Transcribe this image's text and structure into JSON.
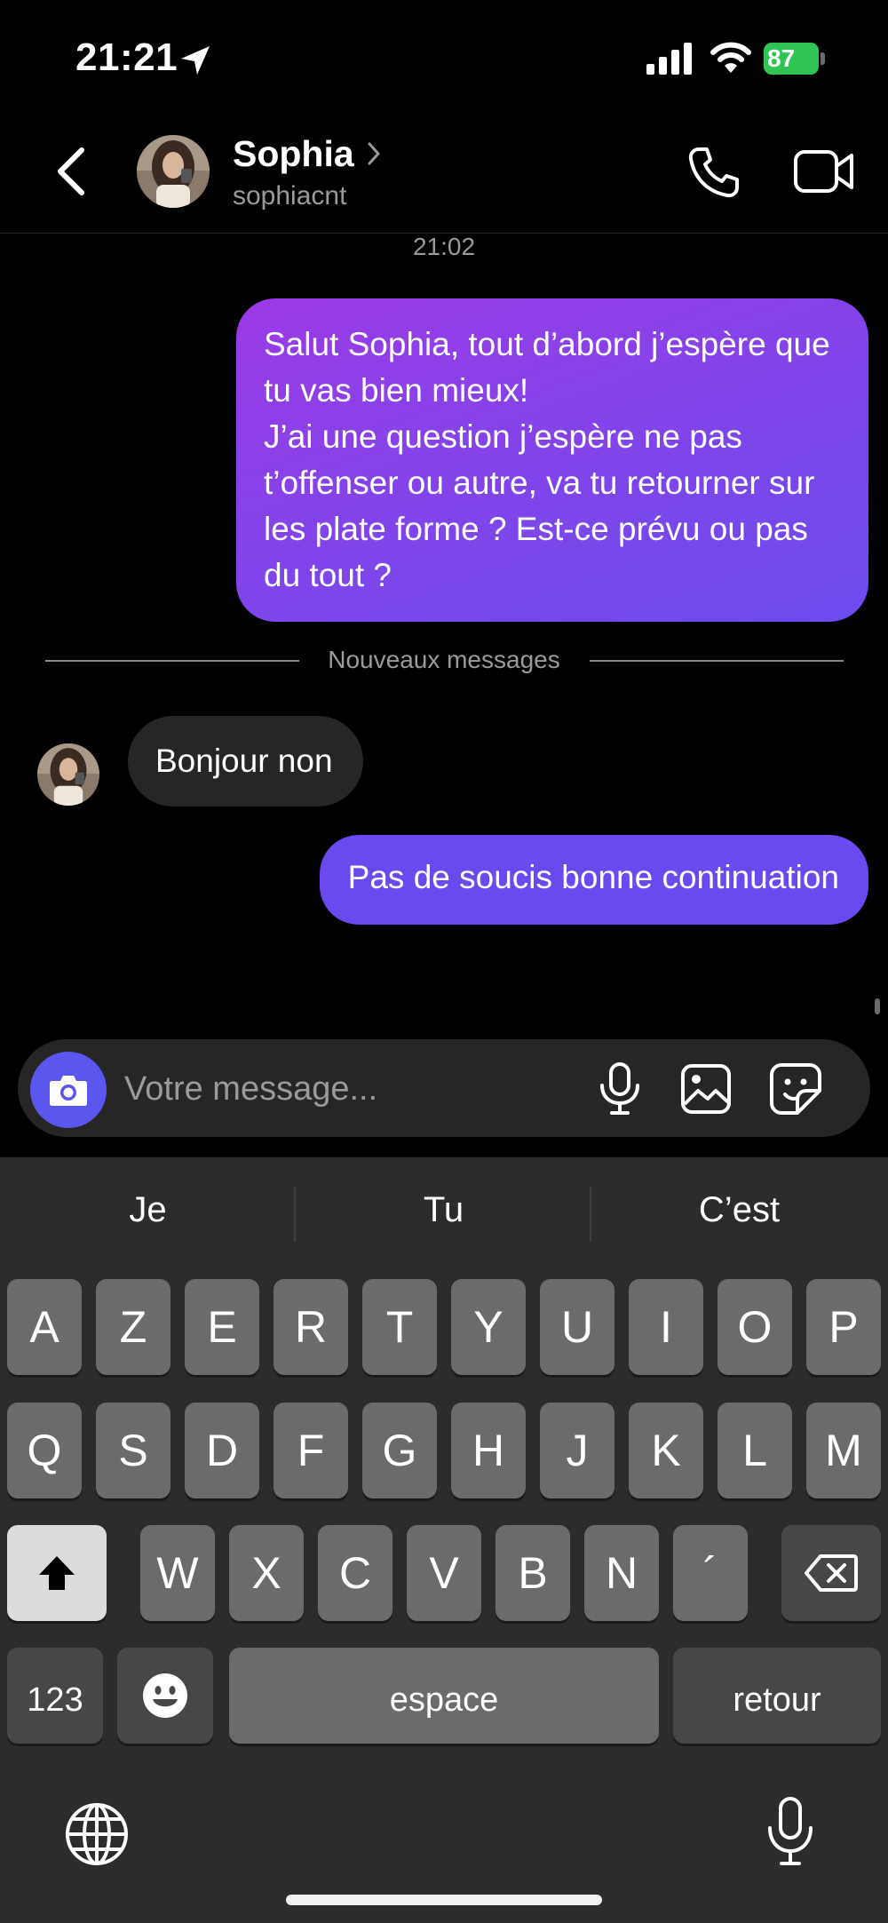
{
  "status_bar": {
    "time": "21:21",
    "battery": "87"
  },
  "header": {
    "name": "Sophia",
    "username": "sophiacnt"
  },
  "chat": {
    "timestamp": "21:02",
    "messages": [
      {
        "direction": "outgoing",
        "paragraphs": [
          "Salut Sophia, tout d’abord j’espère que tu vas bien mieux!",
          "J’ai une question j’espère ne pas t’offenser ou autre, va tu retourner sur les plate forme ? Est-ce prévu ou pas du tout ?"
        ]
      },
      {
        "direction": "incoming",
        "text": "Bonjour non"
      },
      {
        "direction": "outgoing",
        "text": "Pas de soucis bonne continuation"
      }
    ],
    "new_messages_divider": "Nouveaux messages"
  },
  "composer": {
    "placeholder": "Votre message..."
  },
  "keyboard": {
    "suggestions": [
      "Je",
      "Tu",
      "C’est"
    ],
    "row1": [
      "A",
      "Z",
      "E",
      "R",
      "T",
      "Y",
      "U",
      "I",
      "O",
      "P"
    ],
    "row2": [
      "Q",
      "S",
      "D",
      "F",
      "G",
      "H",
      "J",
      "K",
      "L",
      "M"
    ],
    "row3": [
      "W",
      "X",
      "C",
      "V",
      "B",
      "N",
      "´"
    ],
    "numbers_label": "123",
    "space_label": "espace",
    "return_label": "retour"
  },
  "colors": {
    "outgoing_bubble_start": "#9b3ae6",
    "outgoing_bubble_end": "#6c4cee",
    "incoming_bubble": "#262626",
    "camera_button": "#5b57ee",
    "battery": "#31c454"
  },
  "icons": [
    "location-arrow-icon",
    "signal-icon",
    "wifi-icon",
    "back-chevron-icon",
    "chevron-right-icon",
    "phone-icon",
    "video-camera-icon",
    "camera-icon",
    "microphone-icon",
    "image-icon",
    "sticker-icon",
    "shift-arrow-icon",
    "emoji-icon",
    "backspace-icon",
    "globe-icon",
    "dictation-mic-icon"
  ]
}
